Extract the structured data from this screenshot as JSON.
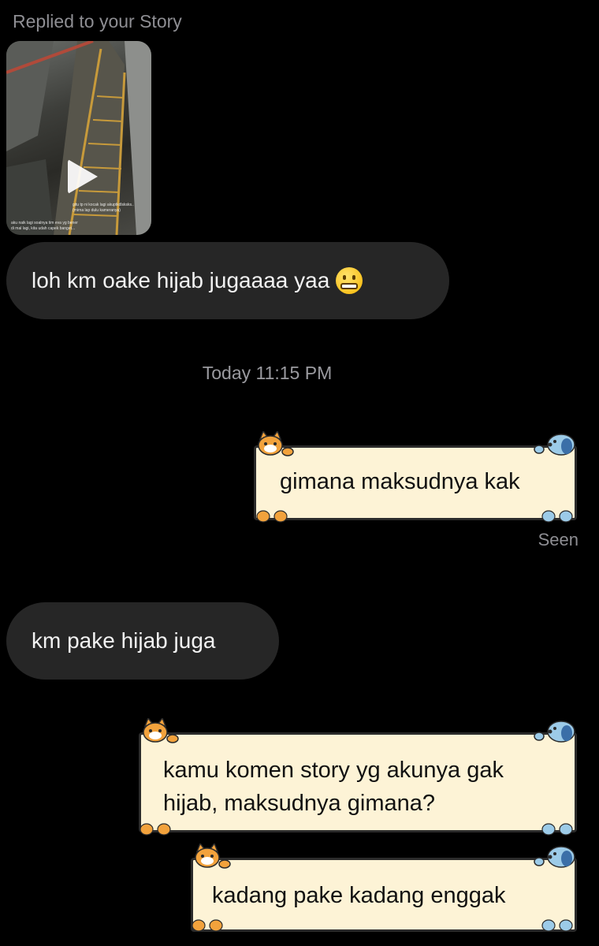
{
  "story": {
    "replied_label": "Replied to your Story",
    "caption_lines": [
      "gitu tp ni kocak lagi akuptkdlsksks..",
      "(mirna lap dulu kameranya)",
      "aku naik lagi soalnya tim eva yg bener",
      "di mal lagi, kita udah capek banget..."
    ]
  },
  "messages": [
    {
      "direction": "in",
      "text": "loh km oake hijab jugaaaa yaa",
      "emoji": "grimacing-face"
    },
    {
      "direction": "out",
      "text": "gimana maksudnya kak"
    },
    {
      "direction": "in",
      "text": "km pake hijab juga"
    },
    {
      "direction": "out",
      "line1": "kamu komen story yg akunya gak",
      "line2": "hijab, maksudnya gimana?"
    },
    {
      "direction": "out",
      "text": "kadang pake kadang enggak"
    }
  ],
  "timestamp": "Today 11:15 PM",
  "seen_label": "Seen",
  "colors": {
    "background": "#000000",
    "incoming_bubble": "#262626",
    "outgoing_bubble": "#fdf3d6",
    "cat": "#f2a23c",
    "dog": "#9ccbe8"
  }
}
